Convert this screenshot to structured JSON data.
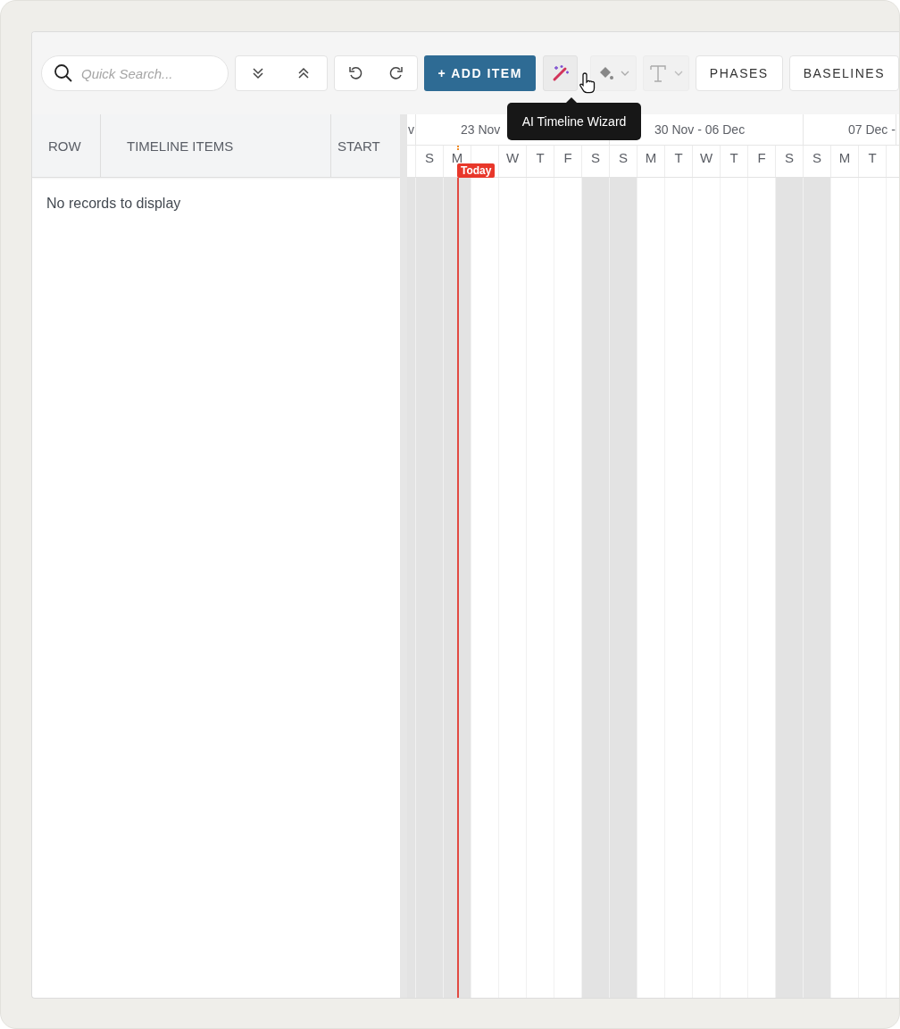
{
  "toolbar": {
    "search": {
      "placeholder": "Quick Search..."
    },
    "add_button": "+ ADD ITEM",
    "tooltip": "AI Timeline Wizard",
    "buttons": [
      "PHASES",
      "BASELINES"
    ]
  },
  "grid": {
    "columns": [
      "ROW",
      "TIMELINE ITEMS",
      "START"
    ],
    "empty_message": "No records to display"
  },
  "timeline": {
    "today_label": "Today",
    "weeks": [
      {
        "label": "v",
        "days": [
          {
            "shaded": true,
            "today": false
          }
        ]
      },
      {
        "label": "23 Nov",
        "days": [
          {
            "letter": "S",
            "shaded": true,
            "today": false
          },
          {
            "letter": "M",
            "shaded": true,
            "today": true
          },
          {
            "shaded": false,
            "today": false
          },
          {
            "letter": "W",
            "shaded": false,
            "today": false
          },
          {
            "letter": "T",
            "shaded": false,
            "today": false
          },
          {
            "letter": "F",
            "shaded": false,
            "today": false
          },
          {
            "letter": "S",
            "shaded": true,
            "today": false
          }
        ]
      },
      {
        "label": "30 Nov - 06 Dec",
        "days": [
          {
            "letter": "S",
            "shaded": true,
            "today": false
          },
          {
            "letter": "M",
            "shaded": false,
            "today": false
          },
          {
            "letter": "T",
            "shaded": false,
            "today": false
          },
          {
            "letter": "W",
            "shaded": false,
            "today": false
          },
          {
            "letter": "T",
            "shaded": false,
            "today": false
          },
          {
            "letter": "F",
            "shaded": false,
            "today": false
          },
          {
            "letter": "S",
            "shaded": true,
            "today": false
          }
        ]
      },
      {
        "label": "07 Dec -",
        "days": [
          {
            "letter": "S",
            "shaded": true,
            "today": false
          },
          {
            "letter": "M",
            "shaded": false,
            "today": false
          },
          {
            "letter": "T",
            "shaded": false,
            "today": false
          }
        ]
      }
    ]
  }
}
